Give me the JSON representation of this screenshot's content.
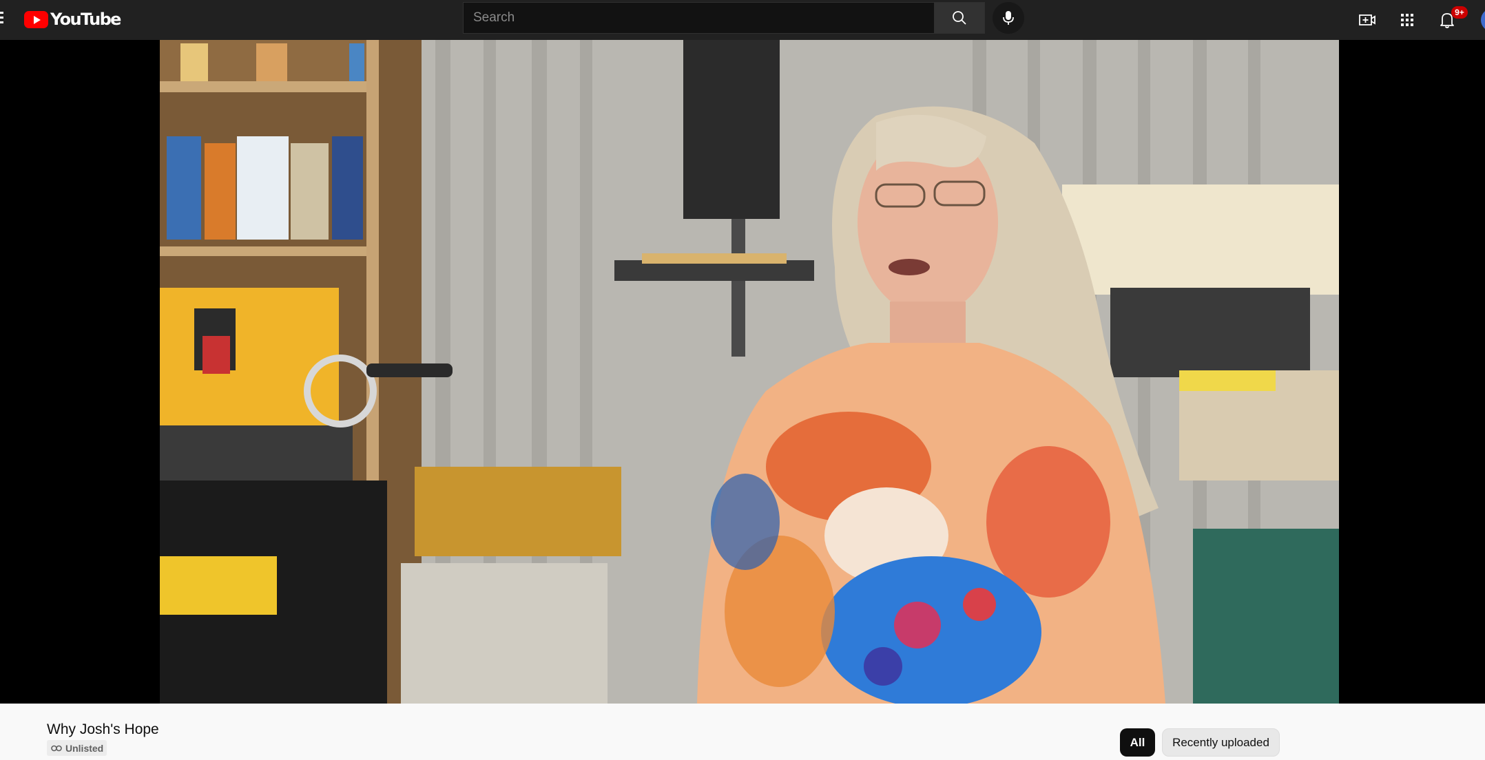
{
  "header": {
    "logo_text": "YouTube",
    "search_placeholder": "Search",
    "notification_count": "9+"
  },
  "icons": {
    "menu": "hamburger-icon",
    "search": "search-icon",
    "mic": "microphone-icon",
    "create": "create-video-icon",
    "apps": "apps-grid-icon",
    "notifications": "bell-icon",
    "account": "avatar"
  },
  "video": {
    "title": "Why Josh's Hope",
    "visibility": "Unlisted"
  },
  "chips": {
    "all": "All",
    "recent": "Recently uploaded"
  },
  "colors": {
    "brand_red": "#ff0000",
    "topbar_bg": "#212121",
    "badge_red": "#cc0000"
  }
}
